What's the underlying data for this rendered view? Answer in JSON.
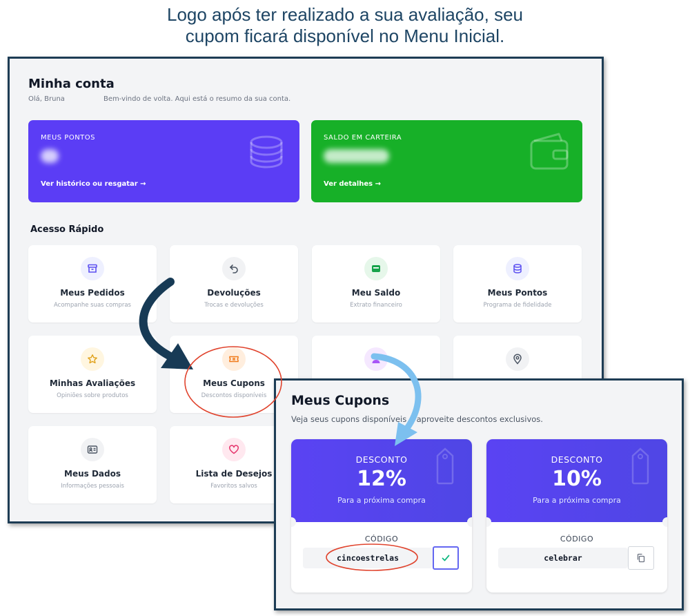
{
  "caption": {
    "line1": "Logo após ter realizado a sua avaliação, seu",
    "line2": "cupom ficará disponível no Menu Inicial."
  },
  "account": {
    "title": "Minha conta",
    "greeting": "Olá, Bruna",
    "welcome": "Bem-vindo de volta. Aqui está o resumo da sua conta.",
    "points_card": {
      "label": "MEUS PONTOS",
      "link": "Ver histórico ou resgatar →",
      "color": "#5b3df5",
      "icon": "coins-stack-icon"
    },
    "wallet_card": {
      "label": "SALDO EM CARTEIRA",
      "link": "Ver detalhes →",
      "color": "#17b028",
      "icon": "wallet-icon"
    },
    "quick_access_title": "Acesso Rápido",
    "tiles": [
      {
        "title": "Meus Pedidos",
        "subtitle": "Acompanhe suas compras",
        "icon": "archive-box-icon"
      },
      {
        "title": "Devoluções",
        "subtitle": "Trocas e devoluções",
        "icon": "return-arrow-icon"
      },
      {
        "title": "Meu Saldo",
        "subtitle": "Extrato financeiro",
        "icon": "wallet-icon"
      },
      {
        "title": "Meus Pontos",
        "subtitle": "Programa de fidelidade",
        "icon": "coins-icon"
      },
      {
        "title": "Minhas Avaliações",
        "subtitle": "Opiniões sobre produtos",
        "icon": "star-icon"
      },
      {
        "title": "Meus Cupons",
        "subtitle": "Descontos disponíveis",
        "icon": "ticket-icon"
      },
      {
        "title": "",
        "subtitle": "",
        "icon": "user-icon"
      },
      {
        "title": "",
        "subtitle": "",
        "icon": "map-pin-icon"
      },
      {
        "title": "Meus Dados",
        "subtitle": "Informações pessoais",
        "icon": "id-card-icon"
      },
      {
        "title": "Lista de Desejos",
        "subtitle": "Favoritos salvos",
        "icon": "heart-icon"
      }
    ]
  },
  "coupons": {
    "title": "Meus Cupons",
    "subtitle": "Veja seus cupons disponíveis e aproveite descontos exclusivos.",
    "items": [
      {
        "label": "DESCONTO",
        "value": "12%",
        "description": "Para a próxima compra",
        "code_label": "CÓDIGO",
        "code": "cincoestrelas",
        "action_icon": "check-icon",
        "copied": true
      },
      {
        "label": "DESCONTO",
        "value": "10%",
        "description": "Para a próxima compra",
        "code_label": "CÓDIGO",
        "code": "celebrar",
        "action_icon": "copy-icon",
        "copied": false
      }
    ]
  },
  "colors": {
    "frame_border": "#1d3c54",
    "highlight_circle": "#e0432d",
    "arrow_dark": "#173a55",
    "arrow_light": "#7cc0ef",
    "coupon_gradient": "#5a43f3"
  }
}
